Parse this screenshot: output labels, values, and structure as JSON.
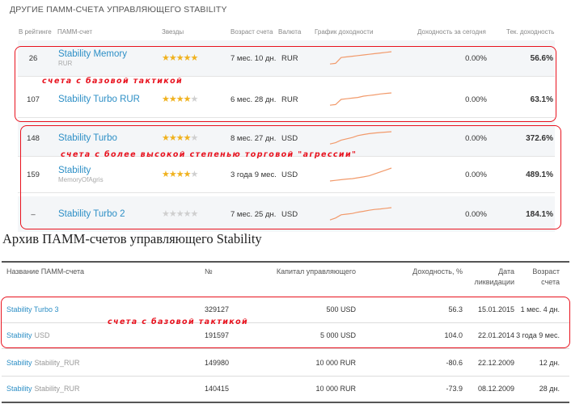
{
  "section_title": "ДРУГИЕ ПАММ-СЧЕТА УПРАВЛЯЮЩЕГО STABILITY",
  "top_table": {
    "headers": {
      "rank": "В рейтинге",
      "account": "ПАММ-счет",
      "stars": "Звезды",
      "age": "Возраст счета",
      "currency": "Валюта",
      "chart": "График доходности",
      "today": "Доходность за сегодня",
      "total": "Тек. доходность"
    },
    "rows": [
      {
        "rank": "26",
        "name": "Stability Memory",
        "sub": "RUR",
        "stars": 4.5,
        "age": "7 мес. 10 дн.",
        "currency": "RUR",
        "today": "0.00%",
        "total": "56.6%",
        "spark": [
          0.05,
          0.1,
          0.55,
          0.6,
          0.65,
          0.7,
          0.75,
          0.8,
          0.85,
          0.9,
          0.95,
          1.0
        ]
      },
      {
        "rank": "107",
        "name": "Stability Turbo RUR",
        "sub": "",
        "stars": 4,
        "age": "6 мес. 28 дн.",
        "currency": "RUR",
        "today": "0.00%",
        "total": "63.1%",
        "spark": [
          0.05,
          0.1,
          0.5,
          0.55,
          0.6,
          0.65,
          0.75,
          0.8,
          0.85,
          0.92,
          0.96,
          1.0
        ]
      },
      {
        "rank": "148",
        "name": "Stability Turbo",
        "sub": "",
        "stars": 4,
        "age": "8 мес. 27 дн.",
        "currency": "USD",
        "today": "0.00%",
        "total": "372.6%",
        "spark": [
          0.05,
          0.15,
          0.35,
          0.45,
          0.55,
          0.7,
          0.78,
          0.85,
          0.9,
          0.94,
          0.97,
          1.0
        ]
      },
      {
        "rank": "159",
        "name": "Stability",
        "sub": "MemoryOfAgris",
        "stars": 4,
        "age": "3 года 9 мес.",
        "currency": "USD",
        "today": "0.00%",
        "total": "489.1%",
        "spark": [
          0.0,
          0.05,
          0.1,
          0.15,
          0.18,
          0.25,
          0.32,
          0.4,
          0.55,
          0.7,
          0.85,
          1.0
        ]
      },
      {
        "rank": "–",
        "name": "Stability Turbo 2",
        "sub": "",
        "stars": 0,
        "age": "7 мес. 25 дн.",
        "currency": "USD",
        "today": "0.00%",
        "total": "184.1%",
        "spark": [
          0.05,
          0.2,
          0.45,
          0.5,
          0.55,
          0.65,
          0.72,
          0.8,
          0.86,
          0.9,
          0.95,
          1.0
        ]
      }
    ]
  },
  "annotations": {
    "base_top": "счета с базовой тактикой",
    "aggressive": "счета с более высокой степенью торговой \"агрессии\"",
    "base_bottom": "счета с базовой тактикой"
  },
  "archive_title": "Архив ПАММ-счетов управляющего Stability",
  "archive_table": {
    "headers": {
      "name": "Название ПАММ-счета",
      "number": "№",
      "capital": "Капитал управляющего",
      "yield": "Доходность, %",
      "date_line1": "Дата",
      "date_line2": "ликвидации",
      "age_line1": "Возраст",
      "age_line2": "счета"
    },
    "rows": [
      {
        "name": "Stability Turbo 3",
        "sub": "",
        "number": "329127",
        "capital": "500 USD",
        "yield": "56.3",
        "date": "15.01.2015",
        "age": "1 мес. 4 дн."
      },
      {
        "name": "Stability",
        "sub": "USD",
        "number": "191597",
        "capital": "5 000 USD",
        "yield": "104.0",
        "date": "22.01.2014",
        "age": "3 года 9 мес."
      },
      {
        "name": "Stability",
        "sub": "Stability_RUR",
        "number": "149980",
        "capital": "10 000 RUR",
        "yield": "-80.6",
        "date": "22.12.2009",
        "age": "12 дн."
      },
      {
        "name": "Stability",
        "sub": "Stability_RUR",
        "number": "140415",
        "capital": "10 000 RUR",
        "yield": "-73.9",
        "date": "08.12.2009",
        "age": "28 дн."
      }
    ]
  },
  "colors": {
    "link": "#2d8fc6",
    "annotation": "#e8121e",
    "star_on": "#f0b21f",
    "star_off": "#cfcfcf",
    "sparkline": "#f29a6b"
  }
}
